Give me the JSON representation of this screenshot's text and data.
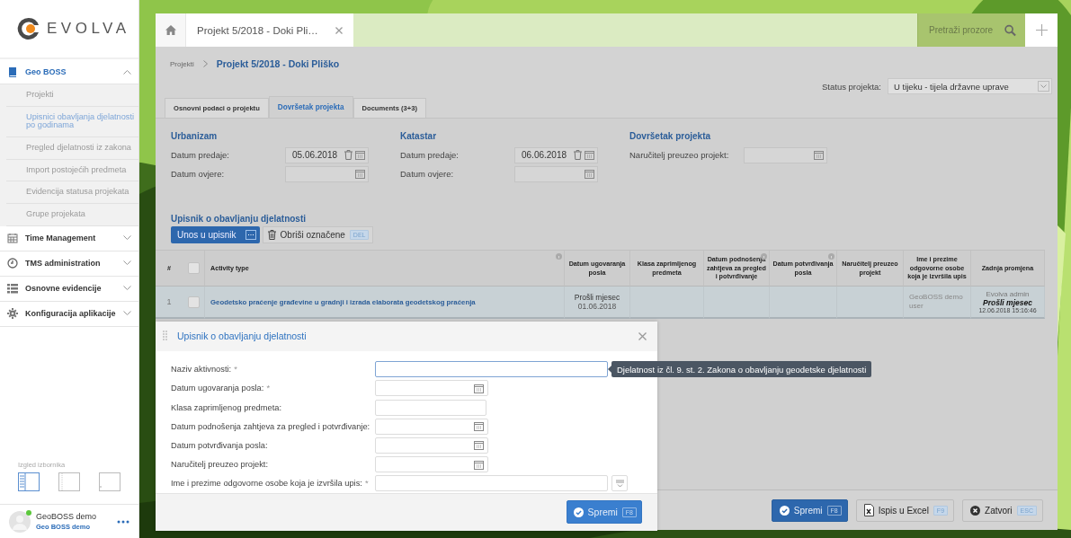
{
  "sidebar": {
    "logo": "EVOLVA",
    "menu": [
      {
        "label": "Geo BOSS",
        "expanded": true,
        "children": [
          {
            "label": "Projekti",
            "selected": false
          },
          {
            "label": "Upisnici obavljanja djelatnosti po godinama",
            "selected": true
          },
          {
            "label": "Pregled djelatnosti iz zakona",
            "selected": false
          },
          {
            "label": "Import postojećih predmeta",
            "selected": false
          },
          {
            "label": "Evidencija statusa projekata",
            "selected": false
          },
          {
            "label": "Grupe projekata",
            "selected": false
          }
        ]
      },
      {
        "label": "Time Management",
        "expanded": false
      },
      {
        "label": "TMS administration",
        "expanded": false
      },
      {
        "label": "Osnovne evidencije",
        "expanded": false
      },
      {
        "label": "Konfiguracija aplikacije",
        "expanded": false
      }
    ],
    "menu_layout": {
      "label": "Izgled izbornika",
      "options": [
        {
          "selected": true
        },
        {
          "selected": false
        },
        {
          "selected": false
        }
      ]
    },
    "user": {
      "name": "GeoBOSS demo",
      "role": "Geo BOSS demo",
      "online": true
    }
  },
  "window_tabs": [
    {
      "kind": "home"
    },
    {
      "kind": "document",
      "label": "Projekt 5/2018 - Doki Pli…"
    }
  ],
  "window_search": {
    "placeholder": "Pretraži prozore"
  },
  "breadcrumb": [
    {
      "label": "Projekti"
    },
    {
      "label": "Projekt 5/2018 - Doki Pliško"
    }
  ],
  "status": {
    "label": "Status projekta:",
    "value": "U tijeku - tijela državne uprave"
  },
  "tabs": [
    {
      "label": "Osnovni podaci o projektu",
      "selected": false
    },
    {
      "label": "Dovršetak projekta",
      "selected": true
    },
    {
      "label": "Documents (3+3)",
      "selected": false
    }
  ],
  "sections": [
    {
      "title": "Urbanizam",
      "fields": [
        {
          "label": "Datum predaje:",
          "value": "05.06.2018"
        },
        {
          "label": "Datum ovjere:"
        }
      ]
    },
    {
      "title": "Katastar",
      "fields": [
        {
          "label": "Datum predaje:",
          "value": "06.06.2018"
        },
        {
          "label": "Datum ovjere:"
        }
      ]
    },
    {
      "title": "Dovršetak projekta",
      "fields": [
        {
          "label": "Naručitelj preuzeo projekt:"
        }
      ]
    }
  ],
  "register": {
    "title": "Upisnik o obavljanju djelatnosti",
    "add_button": "Unos u upisnik",
    "delete_button": "Obriši označene",
    "delete_key": "DEL"
  },
  "table": {
    "columns": [
      {
        "kind": "number",
        "label": "#"
      },
      {
        "kind": "checkbox",
        "checked": false
      },
      {
        "kind": "main",
        "label": "Activity type",
        "info": true
      },
      {
        "kind": "text",
        "label": "Datum ugovaranja posla",
        "info": false
      },
      {
        "kind": "text",
        "label": "Klasa zaprimljenog predmeta",
        "info": false
      },
      {
        "kind": "text",
        "label": "Datum podnošenja zahtjeva za pregled i potvrđivanje",
        "info": true
      },
      {
        "kind": "text",
        "label": "Datum potvrđivanja posla",
        "info": true
      },
      {
        "kind": "text",
        "label": "Naručitelj preuzeo projekt",
        "info": false
      },
      {
        "kind": "text",
        "label": "Ime i prezime odgovorne osobe koja je izvršila upis",
        "info": false
      },
      {
        "kind": "text",
        "label": "Zadnja promjena",
        "info": false
      }
    ],
    "rows": [
      {
        "cells": [
          {
            "kind": "number",
            "text": "1"
          },
          {
            "kind": "checkbox",
            "checked": false
          },
          {
            "kind": "link",
            "text": "Geodetsko praćenje građevine u gradnji i izrada elaborata geodetskog praćenja"
          },
          {
            "kind": "date",
            "text": "Prošli mjesec",
            "sub": "01.06.2018"
          },
          {
            "kind": "empty"
          },
          {
            "kind": "empty"
          },
          {
            "kind": "empty"
          },
          {
            "kind": "empty"
          },
          {
            "kind": "muted",
            "text": "GeoBOSS demo user"
          },
          {
            "kind": "change",
            "user": "Evolva admin",
            "when": "Prošli mjesec",
            "stamp": "12.06.2018 15:16:46"
          }
        ]
      }
    ]
  },
  "footer_buttons": [
    {
      "kind": "primary",
      "label": "Spremi",
      "key": "F8"
    },
    {
      "kind": "default",
      "label": "Ispis u Excel",
      "key": "F9"
    },
    {
      "kind": "default",
      "label": "Zatvori",
      "key": "ESC"
    }
  ],
  "dialog": {
    "title": "Upisnik o obavljanju djelatnosti",
    "fields": [
      {
        "label": "Naziv aktivnosti:",
        "required_mark": "*",
        "kind": "text",
        "focused": true,
        "tooltip": "Djelatnost iz čl. 9. st. 2. Zakona o obavljanju geodetske djelatnosti"
      },
      {
        "label": "Datum ugovaranja posla:",
        "required_mark": "*",
        "kind": "date",
        "focused": false
      },
      {
        "label": "Klasa zaprimljenog predmeta:",
        "kind": "short",
        "focused": false
      },
      {
        "label": "Datum podnošenja zahtjeva za pregled i potvrđivanje:",
        "kind": "date",
        "focused": false
      },
      {
        "label": "Datum potvrđivanja posla:",
        "kind": "date",
        "focused": false
      },
      {
        "label": "Naručitelj preuzeo projekt:",
        "kind": "date",
        "focused": false
      },
      {
        "label": "Ime i prezime odgovorne osobe koja je izvršila upis:",
        "required_mark": "*",
        "kind": "lookup",
        "focused": false
      }
    ],
    "button": {
      "label": "Spremi",
      "key": "F8"
    }
  }
}
